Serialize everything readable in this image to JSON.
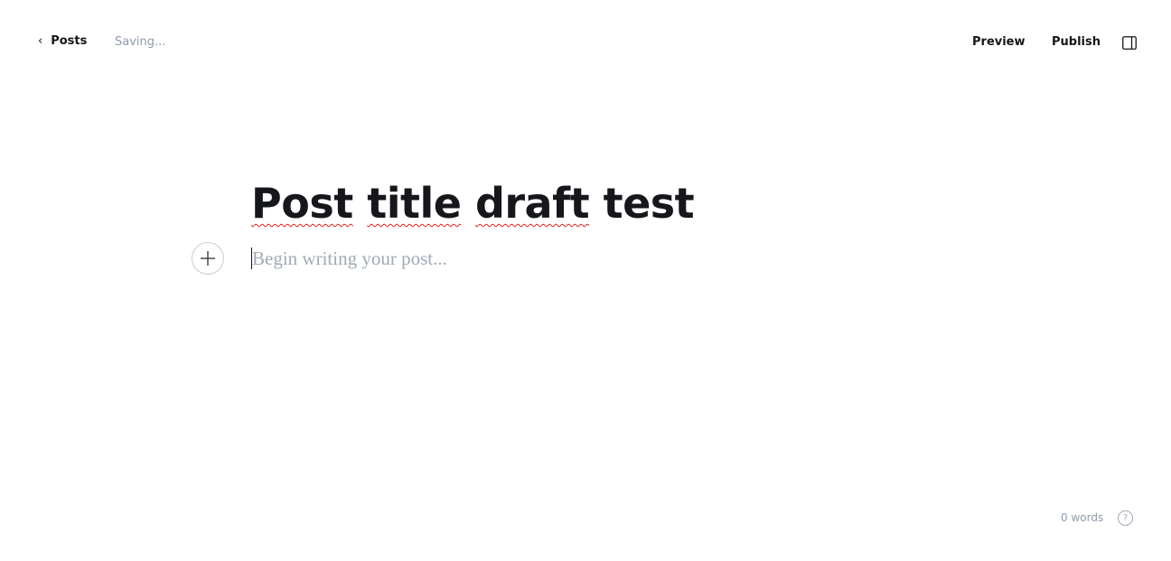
{
  "header": {
    "back_label": "Posts",
    "back_icon": "‹",
    "status": "Saving...",
    "preview_label": "Preview",
    "publish_label": "Publish"
  },
  "editor": {
    "title_words": [
      "Post",
      "title",
      "draft",
      "test"
    ],
    "body_placeholder": "Begin writing your post..."
  },
  "footer": {
    "word_count": "0 words",
    "help_icon": "?"
  }
}
